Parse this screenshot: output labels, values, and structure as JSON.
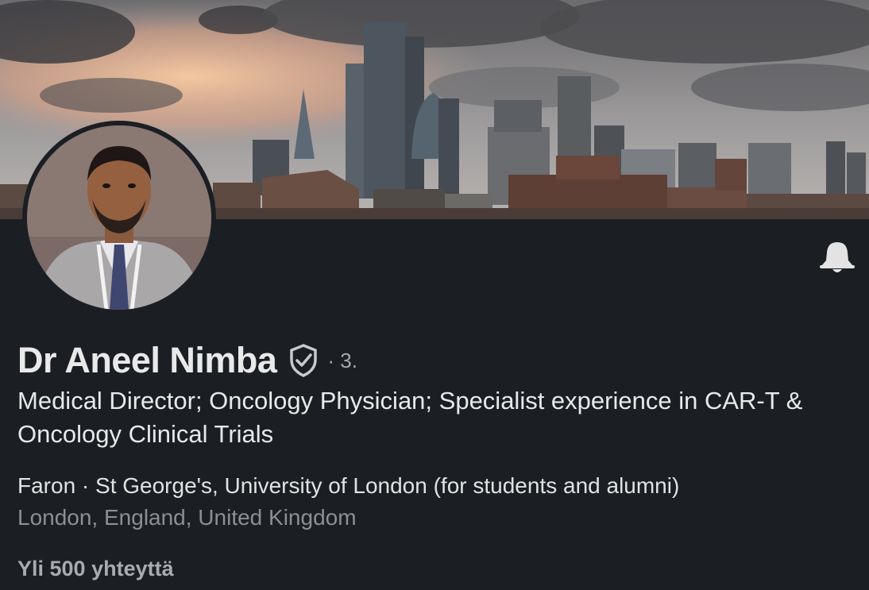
{
  "profile": {
    "name": "Dr Aneel Nimba",
    "degree": "· 3.",
    "headline": "Medical Director; Oncology Physician; Specialist experience in CAR-T & Oncology Clinical Trials",
    "organizations": "Faron · St George's, University of London (for students and alumni)",
    "location": "London, England, United Kingdom",
    "connections": "Yli 500 yhteyttä"
  },
  "icons": {
    "notification": "bell-icon",
    "verified": "verified-shield-icon"
  },
  "colors": {
    "background": "#1b1f23",
    "primary_text": "#e9e9ea",
    "secondary_text": "#8d8f92"
  }
}
